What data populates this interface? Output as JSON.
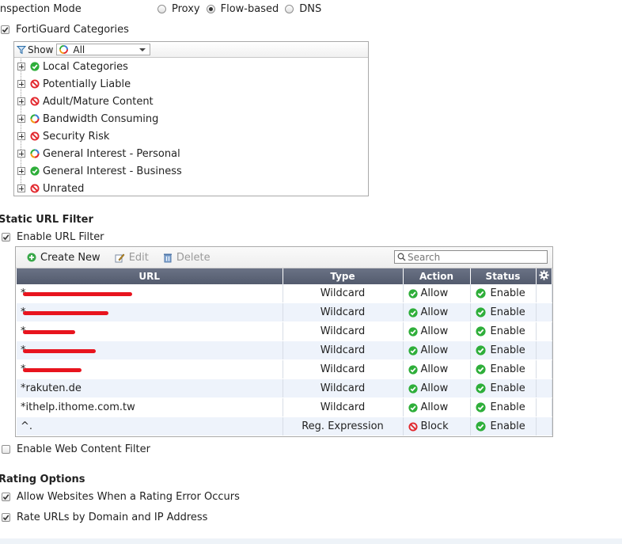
{
  "inspection": {
    "label": "Inspection Mode",
    "options": [
      {
        "label": "Proxy",
        "selected": false
      },
      {
        "label": "Flow-based",
        "selected": true
      },
      {
        "label": "DNS",
        "selected": false
      }
    ]
  },
  "fortiguard": {
    "label": "FortiGuard Categories",
    "checked": true,
    "show_label": "Show",
    "show_value": "All",
    "categories": [
      {
        "label": "Local Categories",
        "status": "allow"
      },
      {
        "label": "Potentially Liable",
        "status": "block"
      },
      {
        "label": "Adult/Mature Content",
        "status": "block"
      },
      {
        "label": "Bandwidth Consuming",
        "status": "mixed"
      },
      {
        "label": "Security Risk",
        "status": "block"
      },
      {
        "label": "General Interest - Personal",
        "status": "mixed"
      },
      {
        "label": "General Interest - Business",
        "status": "allow"
      },
      {
        "label": "Unrated",
        "status": "block"
      }
    ]
  },
  "static_url": {
    "title": "Static URL Filter",
    "enable_label": "Enable URL Filter",
    "enabled": true,
    "toolbar": {
      "create_label": "Create New",
      "edit_label": "Edit",
      "delete_label": "Delete"
    },
    "search_placeholder": "Search",
    "columns": [
      "URL",
      "Type",
      "Action",
      "Status"
    ],
    "rows": [
      {
        "url": "*",
        "type": "Wildcard",
        "action": "Allow",
        "status": "Enable"
      },
      {
        "url": "*",
        "type": "Wildcard",
        "action": "Allow",
        "status": "Enable"
      },
      {
        "url": "*",
        "type": "Wildcard",
        "action": "Allow",
        "status": "Enable"
      },
      {
        "url": "*",
        "type": "Wildcard",
        "action": "Allow",
        "status": "Enable"
      },
      {
        "url": "*",
        "type": "Wildcard",
        "action": "Allow",
        "status": "Enable"
      },
      {
        "url": "*rakuten.de",
        "type": "Wildcard",
        "action": "Allow",
        "status": "Enable"
      },
      {
        "url": "*ithelp.ithome.com.tw",
        "type": "Wildcard",
        "action": "Allow",
        "status": "Enable"
      },
      {
        "url": "^.",
        "type": "Reg. Expression",
        "action": "Block",
        "status": "Enable"
      }
    ]
  },
  "web_content": {
    "label": "Enable Web Content Filter",
    "checked": false
  },
  "rating": {
    "title": "Rating Options",
    "options": [
      {
        "label": "Allow Websites When a Rating Error Occurs",
        "checked": true
      },
      {
        "label": "Rate URLs by Domain and IP Address",
        "checked": true
      }
    ]
  },
  "colors": {
    "allow": "#2eae3a",
    "block": "#e2262c",
    "header": "#5e6678",
    "row_alt": "#eef3fb"
  }
}
